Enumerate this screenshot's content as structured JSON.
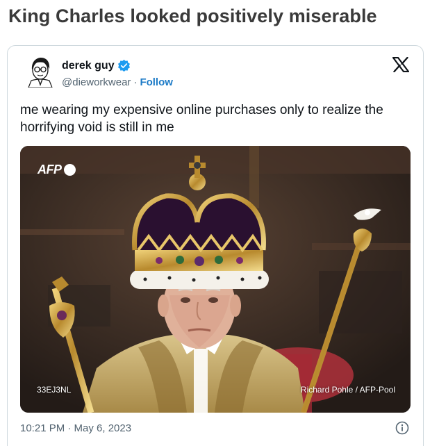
{
  "headline": "King Charles looked positively miserable",
  "tweet": {
    "display_name": "derek guy",
    "handle": "@dieworkwear",
    "separator": "·",
    "follow_label": "Follow",
    "text": "me wearing my expensive online purchases only to realize the horrifying void is still in me",
    "timestamp": "10:21 PM · May 6, 2023",
    "icons": {
      "verified": "verified-badge-icon",
      "platform": "x-logo-icon",
      "info": "info-icon"
    },
    "photo": {
      "agency": "AFP",
      "photo_id": "33EJ3NL",
      "credit": "Richard Pohle / AFP-Pool"
    }
  },
  "colors": {
    "verified": "#1d9bf0",
    "follow": "#1d7bc7",
    "muted": "#536471",
    "border": "#cfd9de"
  }
}
